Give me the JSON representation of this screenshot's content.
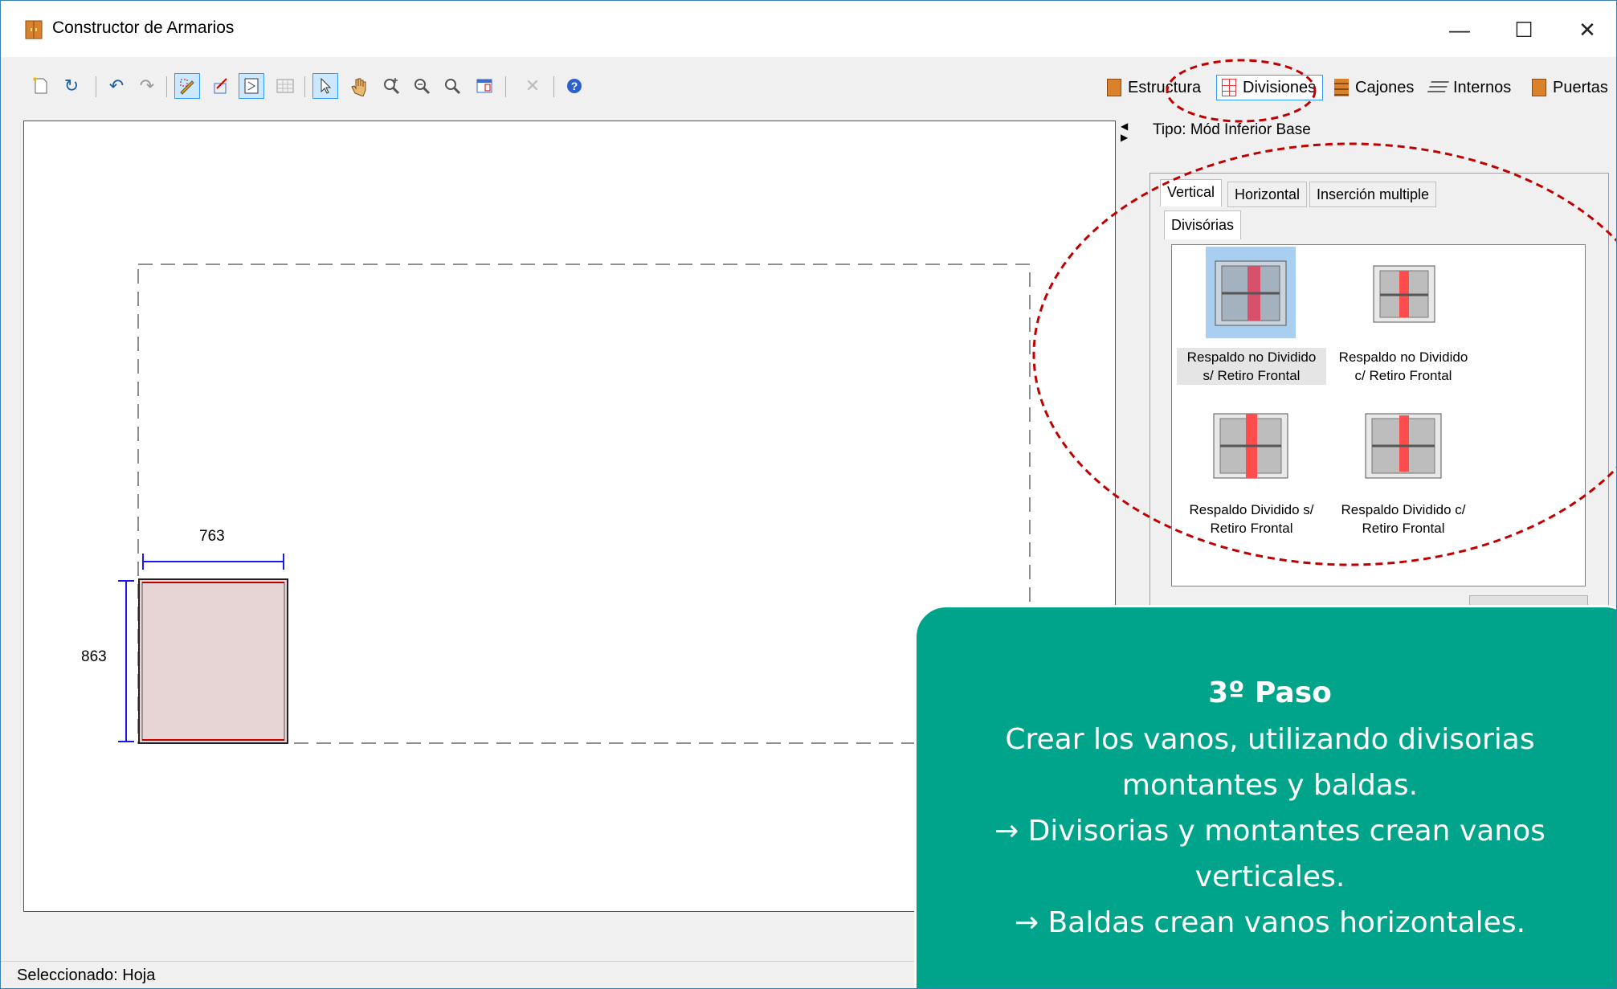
{
  "window": {
    "title": "Constructor de Armarios",
    "controls": {
      "minimize": "—",
      "maximize": "☐",
      "close": "✕"
    }
  },
  "toolbar": {
    "tools": [
      "new-icon",
      "refresh-icon",
      "undo-icon",
      "redo-icon",
      "draw-icon",
      "erase-shape-icon",
      "frame-icon",
      "grid-icon",
      "pointer-icon",
      "pan-icon",
      "zoom-in-icon",
      "zoom-out-icon",
      "zoom-icon",
      "window-icon",
      "delete-icon",
      "help-icon"
    ]
  },
  "modes": {
    "estructura": "Estructura",
    "divisiones": "Divisiones",
    "cajones": "Cajones",
    "internos": "Internos",
    "puertas": "Puertas"
  },
  "panel": {
    "tipo": "Tipo: Mód Inferior Base",
    "tabs": {
      "vertical": "Vertical",
      "horizontal": "Horizontal",
      "insercion": "Inserción multiple"
    },
    "subtab": "Divisórias",
    "items": [
      {
        "line1": "Respaldo no Dividido",
        "line2": "s/ Retiro Frontal"
      },
      {
        "line1": "Respaldo no Dividido",
        "line2": "c/ Retiro Frontal"
      },
      {
        "line1": "Respaldo Dividido s/",
        "line2": "Retiro Frontal"
      },
      {
        "line1": "Respaldo Dividido c/",
        "line2": "Retiro Frontal"
      }
    ]
  },
  "canvas": {
    "width_dim": "763",
    "height_dim": "863"
  },
  "status": {
    "text": "Seleccionado: Hoja"
  },
  "callout": {
    "title": "3º Paso",
    "line1": "Crear los vanos, utilizando divisorias",
    "line2": "montantes y baldas.",
    "line3": "→  Divisorias y montantes crean vanos",
    "line4": "verticales.",
    "line5": "→   Baldas crean vanos horizontales."
  },
  "colors": {
    "accent": "#00a48a",
    "selection": "#cce8ff",
    "annotation": "#c00000",
    "panel_red": "#e8314a"
  }
}
